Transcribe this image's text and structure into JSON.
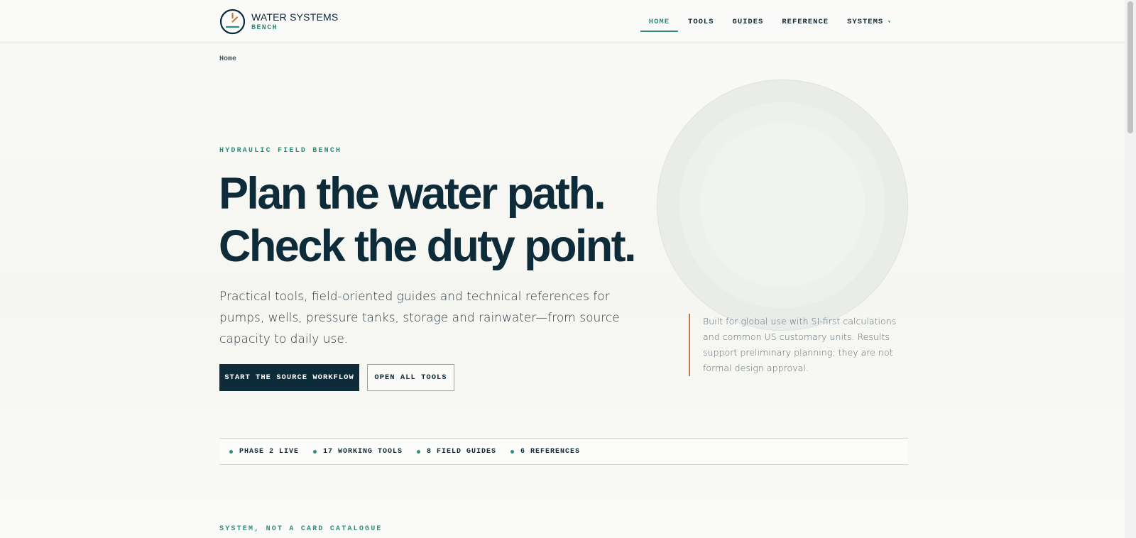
{
  "brand": {
    "title": "WATER SYSTEMS",
    "subtitle": "BENCH",
    "icon": "gauge-icon"
  },
  "nav": {
    "items": [
      {
        "label": "HOME",
        "active": true
      },
      {
        "label": "TOOLS",
        "active": false
      },
      {
        "label": "GUIDES",
        "active": false
      },
      {
        "label": "REFERENCE",
        "active": false
      },
      {
        "label": "SYSTEMS",
        "active": false,
        "caret": "▾"
      }
    ]
  },
  "breadcrumb": {
    "home": "Home"
  },
  "hero": {
    "eyebrow": "HYDRAULIC FIELD BENCH",
    "headline_line1": "Plan the water path.",
    "headline_line2": "Check the duty point.",
    "lead": "Practical tools, field-oriented guides and technical references for pumps, wells, pressure tanks, storage and rainwater—from source capacity to daily use.",
    "primary_cta": "START THE SOURCE WORKFLOW",
    "secondary_cta": "OPEN ALL TOOLS",
    "note": "Built for global use with SI-first calculations and common US customary units. Results support preliminary planning; they are not formal design approval."
  },
  "stats": [
    {
      "label": "PHASE 2 LIVE"
    },
    {
      "label": "17 WORKING TOOLS"
    },
    {
      "label": "8 FIELD GUIDES"
    },
    {
      "label": "6 REFERENCES"
    }
  ],
  "next_section": {
    "eyebrow": "SYSTEM, NOT A CARD CATALOGUE"
  },
  "colors": {
    "accent": "#2f8d7c",
    "ink": "#0d2b38",
    "note_rule": "#c07a3f",
    "background": "#f8f8f5"
  }
}
